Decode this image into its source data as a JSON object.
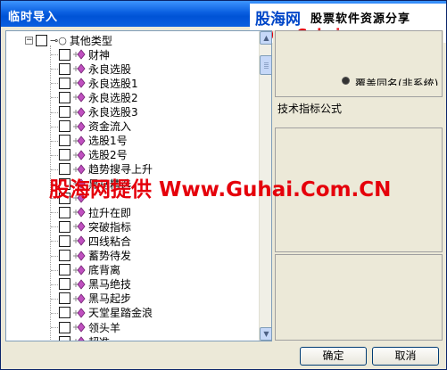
{
  "window": {
    "title": "临时导入"
  },
  "watermark_top": {
    "brand": "股海网",
    "brand_sub": "股票软件资源分享",
    "url": "www.Guhai.com.cn"
  },
  "tree": {
    "root": {
      "label": "其他类型",
      "expanded": true,
      "expander": "−"
    },
    "items": [
      {
        "label": "财神"
      },
      {
        "label": "永良选股"
      },
      {
        "label": "永良选股1"
      },
      {
        "label": "永良选股2"
      },
      {
        "label": "永良选股3"
      },
      {
        "label": "资金流入"
      },
      {
        "label": "选股1号"
      },
      {
        "label": "选股2号"
      },
      {
        "label": "趋势搜寻上升"
      },
      {
        "label": "黑马精选"
      },
      {
        "label": ""
      },
      {
        "label": "拉升在即"
      },
      {
        "label": "突破指标"
      },
      {
        "label": "四线粘合"
      },
      {
        "label": "蓄势待发"
      },
      {
        "label": "底背离"
      },
      {
        "label": "黑马绝技"
      },
      {
        "label": "黑马起步"
      },
      {
        "label": "天堂星踏金浪"
      },
      {
        "label": "领头羊"
      },
      {
        "label": "超准"
      }
    ]
  },
  "right_panel": {
    "partial_text": "覆盖同名(非系统)",
    "formula_label": "技术指标公式"
  },
  "big_watermark": "股海网提供 Www.Guhai.Com.CN",
  "buttons": {
    "ok": "确定",
    "cancel": "取消"
  },
  "icons": {
    "key": "key-icon",
    "node": "indicator-node-icon",
    "scroll_up": "scroll-up-icon",
    "scroll_down": "scroll-down-icon"
  }
}
